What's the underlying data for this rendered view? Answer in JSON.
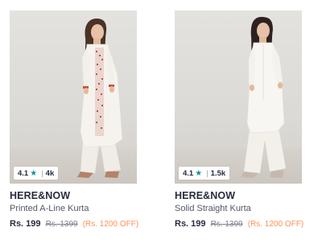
{
  "products": [
    {
      "rating": "4.1",
      "rating_count": "4k",
      "brand": "HERE&NOW",
      "title": "Printed A-Line Kurta",
      "price": "Rs. 199",
      "mrp": "Rs. 1399",
      "discount": "(Rs. 1200 OFF)"
    },
    {
      "rating": "4.1",
      "rating_count": "1.5k",
      "brand": "HERE&NOW",
      "title": "Solid Straight Kurta",
      "price": "Rs. 199",
      "mrp": "Rs. 1399",
      "discount": "(Rs. 1200 OFF)"
    }
  ],
  "icons": {
    "rating_star": "star-icon"
  },
  "colors": {
    "rating_star": "#14958f",
    "discount": "#ff905a",
    "brand_text": "#282c3f"
  }
}
